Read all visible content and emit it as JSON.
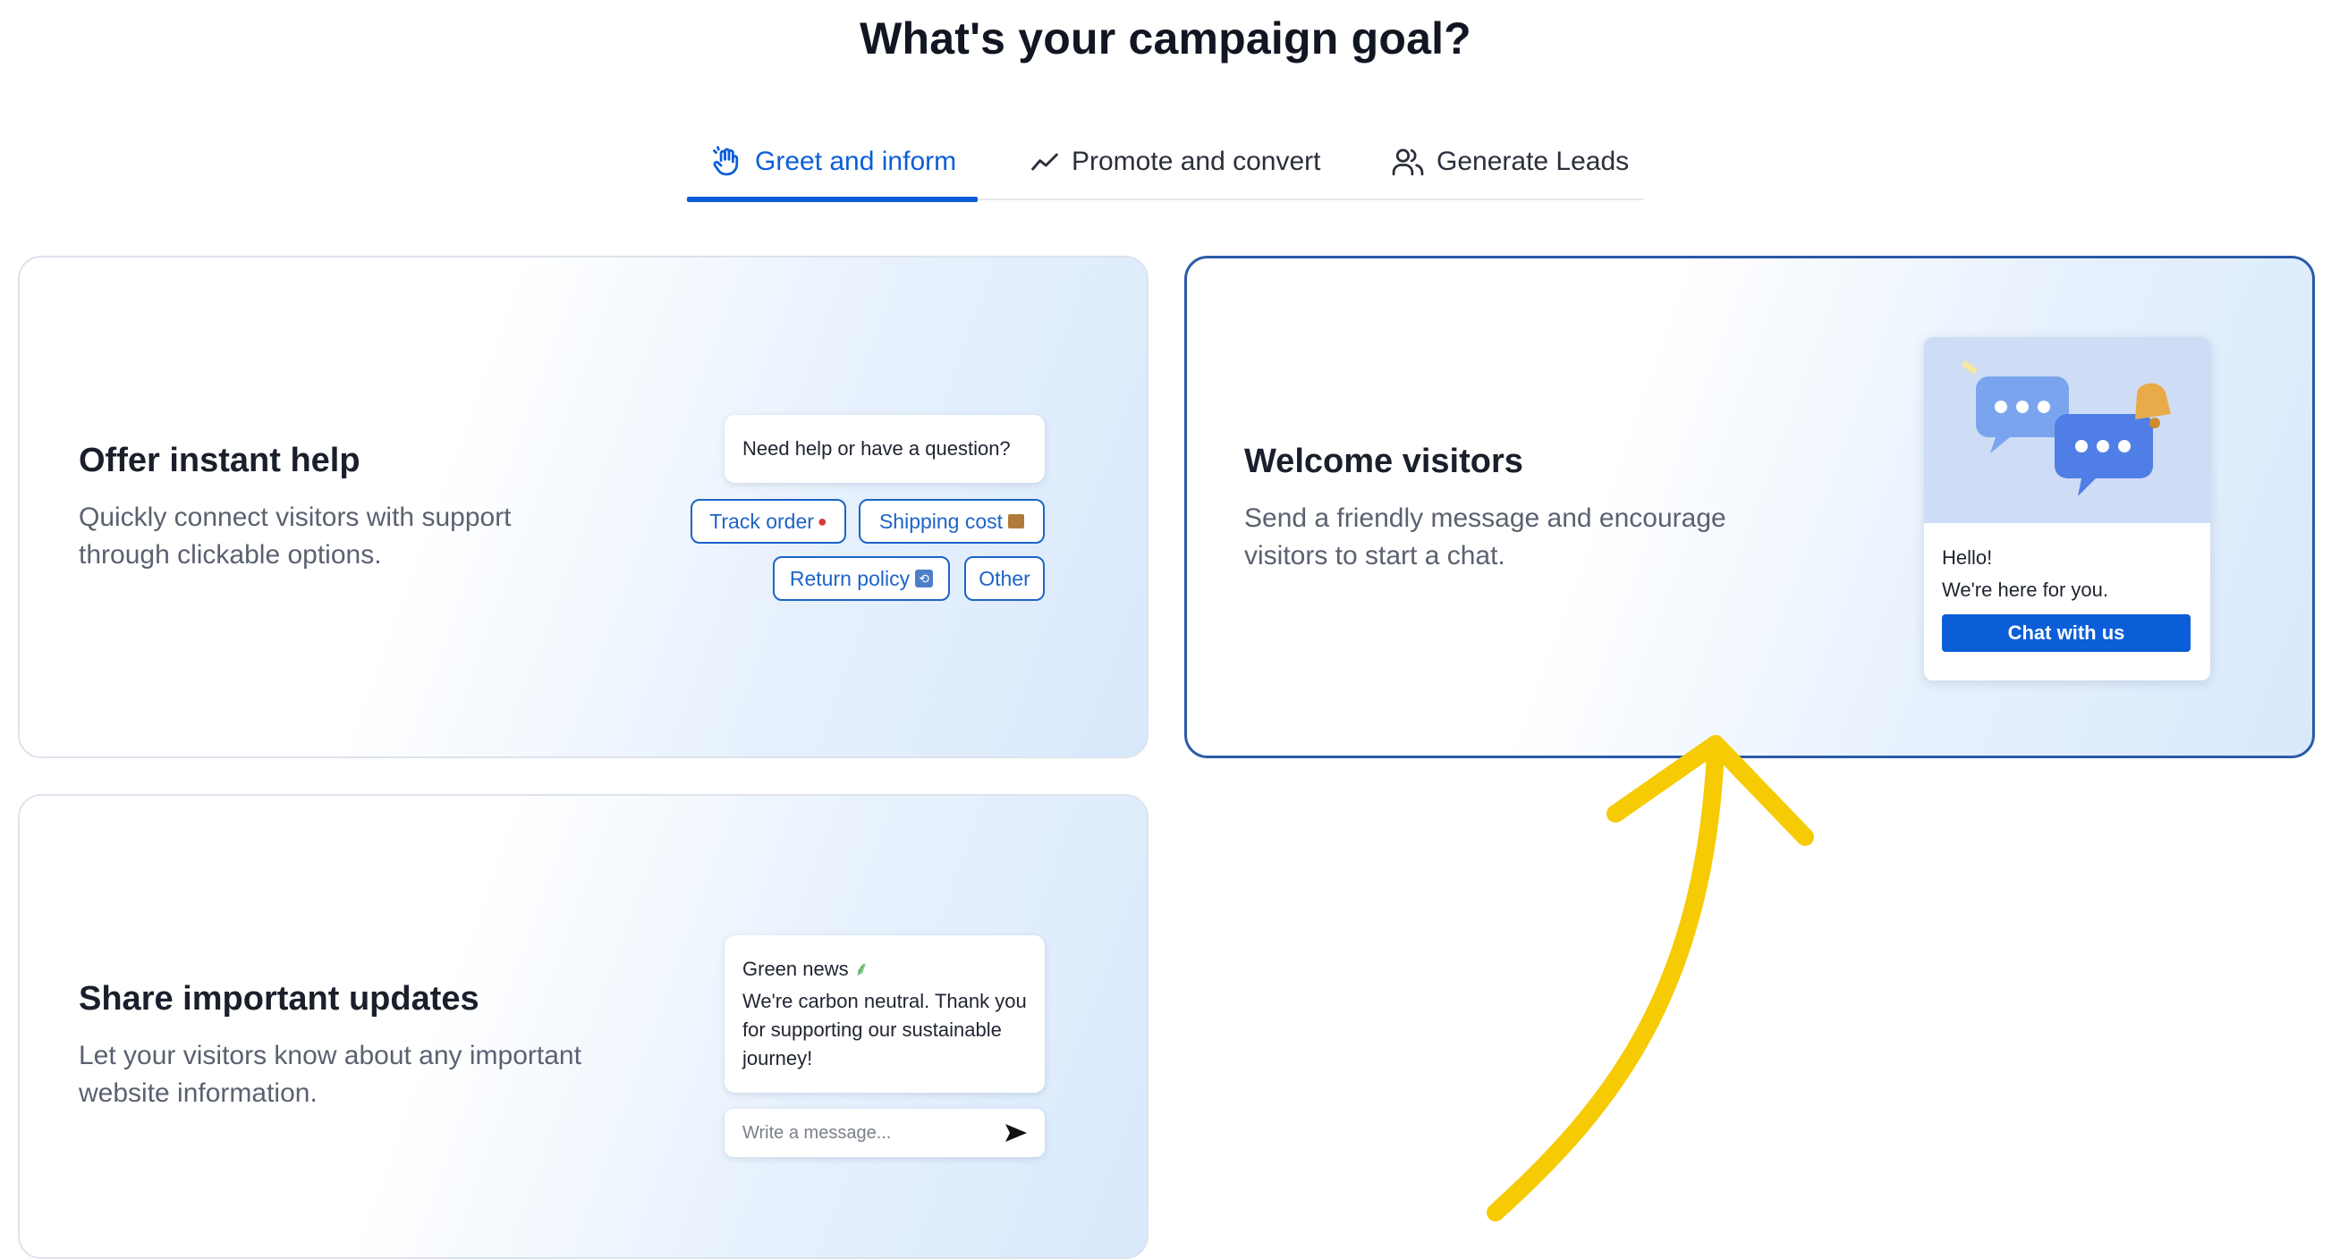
{
  "page": {
    "title": "What's your campaign goal?"
  },
  "tabs": [
    {
      "label": "Greet and inform",
      "icon": "waving-hand-icon",
      "active": true
    },
    {
      "label": "Promote and convert",
      "icon": "trend-line-icon",
      "active": false
    },
    {
      "label": "Generate Leads",
      "icon": "users-icon",
      "active": false
    }
  ],
  "cards": {
    "offer_help": {
      "title": "Offer instant help",
      "description": "Quickly connect visitors with support through clickable options.",
      "preview": {
        "question": "Need help or have a question?",
        "options": [
          {
            "label": "Track order",
            "emoji": "📍"
          },
          {
            "label": "Shipping cost",
            "emoji": "📦"
          },
          {
            "label": "Return policy",
            "emoji": "🔁"
          },
          {
            "label": "Other",
            "emoji": ""
          }
        ]
      }
    },
    "welcome": {
      "title": "Welcome visitors",
      "description": "Send a friendly message and encourage visitors to start a chat.",
      "selected": true,
      "preview": {
        "greeting": "Hello!",
        "message": "We're here for you.",
        "button": "Chat with us"
      }
    },
    "updates": {
      "title": "Share important updates",
      "description": "Let your visitors know about any important website information.",
      "preview": {
        "heading": "Green news",
        "heading_emoji": "🌱",
        "message": "We're carbon neutral. Thank you for supporting our sustainable journey!",
        "input_placeholder": "Write a message..."
      }
    }
  },
  "colors": {
    "accent": "#0b5ed7",
    "selected_border": "#2b5aa8",
    "annotation_arrow": "#f6cb04"
  }
}
